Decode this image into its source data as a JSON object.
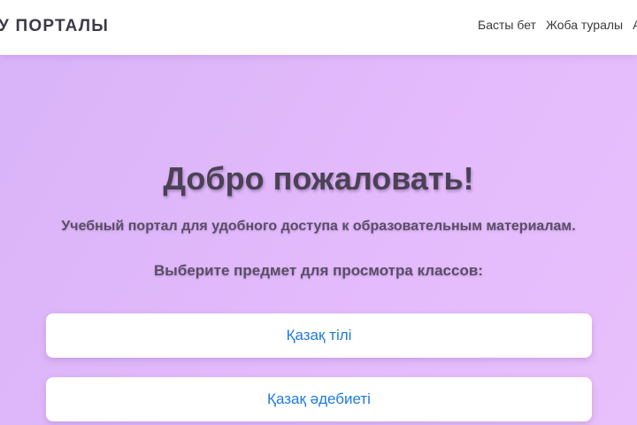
{
  "header": {
    "brand": "У ПОРТАЛЫ",
    "nav": [
      "Басты бет",
      "Жоба туралы",
      "А"
    ]
  },
  "hero": {
    "title": "Добро пожаловать!",
    "subtitle": "Учебный портал для удобного доступа к образовательным материалам.",
    "prompt": "Выберите предмет для просмотра классов:"
  },
  "subjects": [
    {
      "label": "Қазақ тілі"
    },
    {
      "label": "Қазақ әдебиеті"
    }
  ],
  "colors": {
    "background_gradient": [
      "#d8b3f7",
      "#e8c0fb"
    ],
    "header_bg": "#ffffff",
    "link_blue": "#1f7ae0",
    "heading_text": "#4a4254"
  }
}
